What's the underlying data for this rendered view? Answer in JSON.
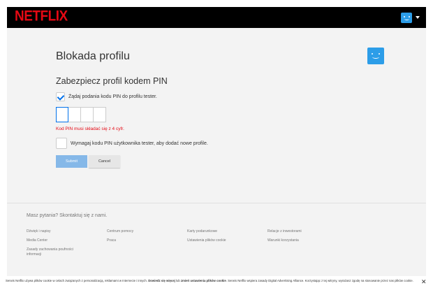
{
  "header": {
    "logo": "NETFLIX"
  },
  "main": {
    "title": "Blokada profilu",
    "subtitle": "Zabezpiecz profil kodem PIN",
    "require_pin_label": "Żądaj podania kodu PIN do profilu tester.",
    "require_pin_checked": true,
    "pin_values": [
      "",
      "",
      "",
      ""
    ],
    "pin_error": "Kod PIN musi składać się z 4 cyfr.",
    "new_profile_label": "Wymagaj kodu PIN użytkownika tester, aby dodać nowe profile.",
    "new_profile_checked": false,
    "submit_label": "Submit",
    "cancel_label": "Cancel"
  },
  "footer": {
    "contact": "Masz pytania? Skontaktuj się z nami.",
    "links": [
      "Dźwięk i napisy",
      "Centrum pomocy",
      "Karty podarunkowe",
      "Relacje z inwestorami",
      "Media Center",
      "Praca",
      "Ustawienia plików cookie",
      "Warunki korzystania",
      "Zasady zachowania poufności informacji"
    ]
  },
  "cookie_banner": {
    "text_start": "Serwis Netflix używa plików cookie w celach związanych z personalizacją, reklamami w Internecie i innych. ",
    "learn_more": "Dowiedz się więcej",
    "or": " lub ",
    "change_settings": "zmień ustawienia plików cookie",
    "text_end": ". Serwis Netflix wspiera zasady Digital Advertising Alliance. Korzystając z tej witryny, wyrażasz zgodę na stosowanie przez nas plików cookie.",
    "close_icon": "close-icon"
  },
  "colors": {
    "brand": "#e50914",
    "avatar": "#2c9de8",
    "submit_disabled": "#85b8e8",
    "error": "#e50914"
  }
}
